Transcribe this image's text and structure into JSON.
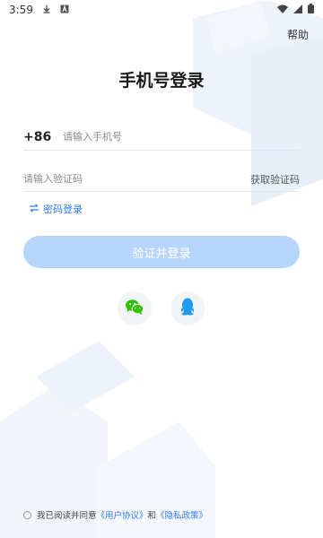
{
  "status_bar": {
    "time": "3:59"
  },
  "header": {
    "help_label": "帮助",
    "title": "手机号登录"
  },
  "phone": {
    "country_code": "+86",
    "placeholder": "请输入手机号"
  },
  "code": {
    "placeholder": "请输入验证码",
    "get_code_label": "获取验证码"
  },
  "password_login_label": "密码登录",
  "submit_label": "验证并登录",
  "social": {
    "wechat_icon": "wechat-icon",
    "qq_icon": "qq-icon"
  },
  "agreement": {
    "prefix": "我已阅读并同意",
    "user_agreement": "《用户协议》",
    "and": "和",
    "privacy_policy": "《隐私政策》"
  },
  "colors": {
    "accent": "#2f7cf0",
    "button_disabled": "#b7d4fb",
    "wechat": "#2dc100",
    "qq": "#1e9bf0"
  }
}
